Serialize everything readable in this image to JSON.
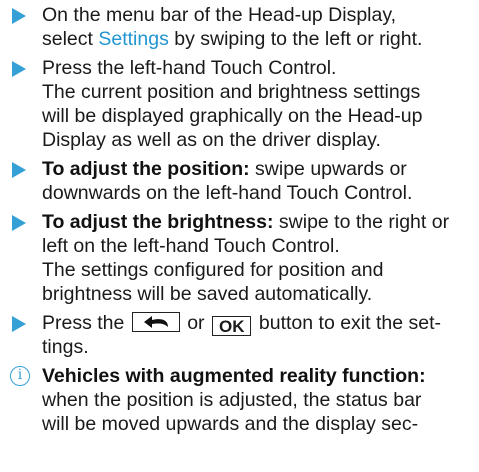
{
  "steps": [
    {
      "lines": [
        {
          "pre": "On the menu bar of the Head-up Display,"
        },
        {
          "pre": "select ",
          "highlight": "Settings",
          "post": " by swiping to the left or right."
        }
      ]
    },
    {
      "lines": [
        "Press the left-hand Touch Control.",
        "The current position and brightness settings",
        "will be displayed graphically on the Head-up",
        "Display as well as on the driver display."
      ]
    },
    {
      "bold": "To adjust the position:",
      "lines": [
        " swipe upwards or",
        "downwards on the left-hand Touch Control."
      ]
    },
    {
      "bold": "To adjust the brightness:",
      "lines": [
        " swipe to the right or",
        "left on the left-hand Touch Control.",
        "The settings configured for position and",
        "brightness will be saved automatically."
      ]
    },
    {
      "pre": "Press the ",
      "mid": " or ",
      "ok_label": "OK",
      "post": " button to exit the set-",
      "line2": "tings.",
      "back_icon": "back-arrow-icon"
    }
  ],
  "info": {
    "icon": "info-icon",
    "icon_glyph": "i",
    "bold": "Vehicles with augmented reality function:",
    "lines": [
      "when the position is adjusted, the status bar",
      "will be moved upwards and the display sec-"
    ]
  },
  "colors": {
    "arrow": "#35a0d6",
    "highlight": "#2196d3",
    "text": "#1a1a1a"
  }
}
